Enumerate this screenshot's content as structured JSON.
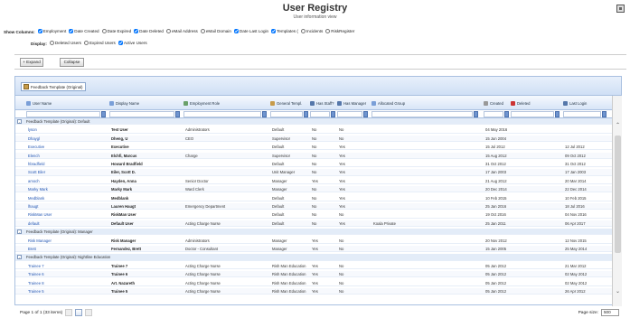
{
  "header": {
    "title": "User Registry",
    "subtitle": "User information view"
  },
  "show_columns": {
    "label": "Show Columns:",
    "options": [
      {
        "label": "Employment",
        "checked": true
      },
      {
        "label": "Date Created",
        "checked": true
      },
      {
        "label": "Date Expired",
        "checked": false
      },
      {
        "label": "Date Deleted",
        "checked": true
      },
      {
        "label": "eMail Address",
        "checked": false
      },
      {
        "label": "eMail Domain",
        "checked": false
      },
      {
        "label": "Date Last Login",
        "checked": true
      },
      {
        "label": "Templates (",
        "checked": true
      },
      {
        "label": "Incidents",
        "checked": false
      },
      {
        "label": "RiskRegister",
        "checked": false
      }
    ]
  },
  "display": {
    "label": "Display:",
    "options": [
      {
        "label": "Deleted Users",
        "checked": false
      },
      {
        "label": "Expired Users",
        "checked": false
      },
      {
        "label": "Active Users",
        "checked": true
      }
    ]
  },
  "toolbar": {
    "expand_label": "+ Expand",
    "collapse_label": "Collapse"
  },
  "group_panel": {
    "chip_label": "Feedback Template (Original)"
  },
  "columns": [
    "User Name",
    "Display Name",
    "Employment Role",
    "General Templ.",
    "Has Staff?",
    "Has Manager",
    "Allocated Group",
    "Created",
    "Deleted",
    "Last Login"
  ],
  "rows": [
    {
      "type": "group",
      "text": "Feedback Template (Original): Default"
    },
    {
      "cells": [
        "lyson",
        "Test User",
        "Administrators",
        "Default",
        "No",
        "No",
        "",
        "04 May 2016",
        "",
        ""
      ]
    },
    {
      "cells": [
        "Dhaygl",
        "Dheng, U",
        "CEO",
        "Supervisor",
        "No",
        "No",
        "",
        "15 Jun 2004",
        "",
        ""
      ]
    },
    {
      "cells": [
        "Executive",
        "Executive",
        "",
        "Default",
        "No",
        "Yes",
        "",
        "15 Jul 2012",
        "",
        "12 Jul 2012"
      ]
    },
    {
      "cells": [
        "Elench",
        "Elchfi, Marcus",
        "Charge",
        "Supervisor",
        "No",
        "Yes",
        "",
        "15 Aug 2012",
        "",
        "09 Oct 2012"
      ]
    },
    {
      "cells": [
        "hbradfield",
        "Howard Bradfield",
        "",
        "Default",
        "No",
        "Yes",
        "",
        "31 Oct 2012",
        "",
        "31 Oct 2012"
      ]
    },
    {
      "cells": [
        "Scott Eiler",
        "Eiler, Scott D.",
        "",
        "Unit Manager",
        "No",
        "Yes",
        "",
        "17 Jan 2003",
        "",
        "17 Jan 2003"
      ]
    },
    {
      "cells": [
        "amoch",
        "Hayden, Anna",
        "Senior Doctor",
        "Manager",
        "Yes",
        "Yes",
        "",
        "21 Aug 2012",
        "",
        "20 Mar 2014"
      ]
    },
    {
      "cells": [
        "Marky Mark",
        "Marky Mark",
        "Ward Clerk",
        "Manager",
        "No",
        "Yes",
        "",
        "20 Dec 2014",
        "",
        "22 Dec 2014"
      ]
    },
    {
      "cells": [
        "Medblank",
        "Medblank",
        "",
        "Default",
        "No",
        "Yes",
        "",
        "10 Feb 2015",
        "",
        "10 Feb 2015"
      ]
    },
    {
      "cells": [
        "lhaugt",
        "Lauren Haugt",
        "Emergency Department",
        "Default",
        "No",
        "Yes",
        "",
        "25 Jan 2016",
        "",
        "18 Jul 2016"
      ]
    },
    {
      "cells": [
        "RiskMan User",
        "RiskMan User",
        "",
        "Default",
        "No",
        "No",
        "",
        "19 Oct 2016",
        "",
        "04 Nov 2016"
      ]
    },
    {
      "cells": [
        "default",
        "Default User",
        "Acting Charge Nurse",
        "Default",
        "No",
        "Yes",
        "Koala Private",
        "25 Jan 2011",
        "",
        "06 Apr 2017"
      ]
    },
    {
      "type": "group",
      "text": "Feedback Template (Original): Manager"
    },
    {
      "cells": [
        "Risk Manager",
        "Risk Manager",
        "Administrators",
        "Manager",
        "Yes",
        "No",
        "",
        "20 Nov 2012",
        "",
        "12 Nov 2015"
      ]
    },
    {
      "cells": [
        "Brett",
        "Fernandez, Brett",
        "Doctor - Consultant",
        "Manager",
        "Yes",
        "No",
        "",
        "15 Jan 2005",
        "",
        "25 May 2014"
      ]
    },
    {
      "type": "group",
      "text": "Feedback Template (Original): Nightline Education"
    },
    {
      "cells": [
        "Trainee 7",
        "Trainee 7",
        "Acting Charge Nurse",
        "Rish Man Education",
        "Yes",
        "No",
        "",
        "05 Jan 2012",
        "",
        "21 Mar 2012"
      ]
    },
    {
      "cells": [
        "Trainee 6",
        "Trainee 6",
        "Acting Charge Nurse",
        "Rish Man Education",
        "Yes",
        "No",
        "",
        "05 Jan 2012",
        "",
        "02 May 2012"
      ]
    },
    {
      "cells": [
        "Trainee 8",
        "Art. Nazareth",
        "Acting Charge Nurse",
        "Rish Man Education",
        "Yes",
        "No",
        "",
        "05 Jan 2012",
        "",
        "02 May 2012"
      ]
    },
    {
      "cells": [
        "Trainee 5",
        "Trainee 5",
        "Acting Charge Nurse",
        "Rish Man Education",
        "Yes",
        "No",
        "",
        "05 Jan 2012",
        "",
        "26 Apr 2012"
      ]
    }
  ],
  "pager": {
    "text": "Page 1 of 1 (33 items)"
  },
  "page_size": {
    "label": "Page size:",
    "value": "500"
  },
  "colors": {
    "header_bg": "#d8e5f7",
    "group_row": "#e3ecf8",
    "link": "#2155b3"
  }
}
